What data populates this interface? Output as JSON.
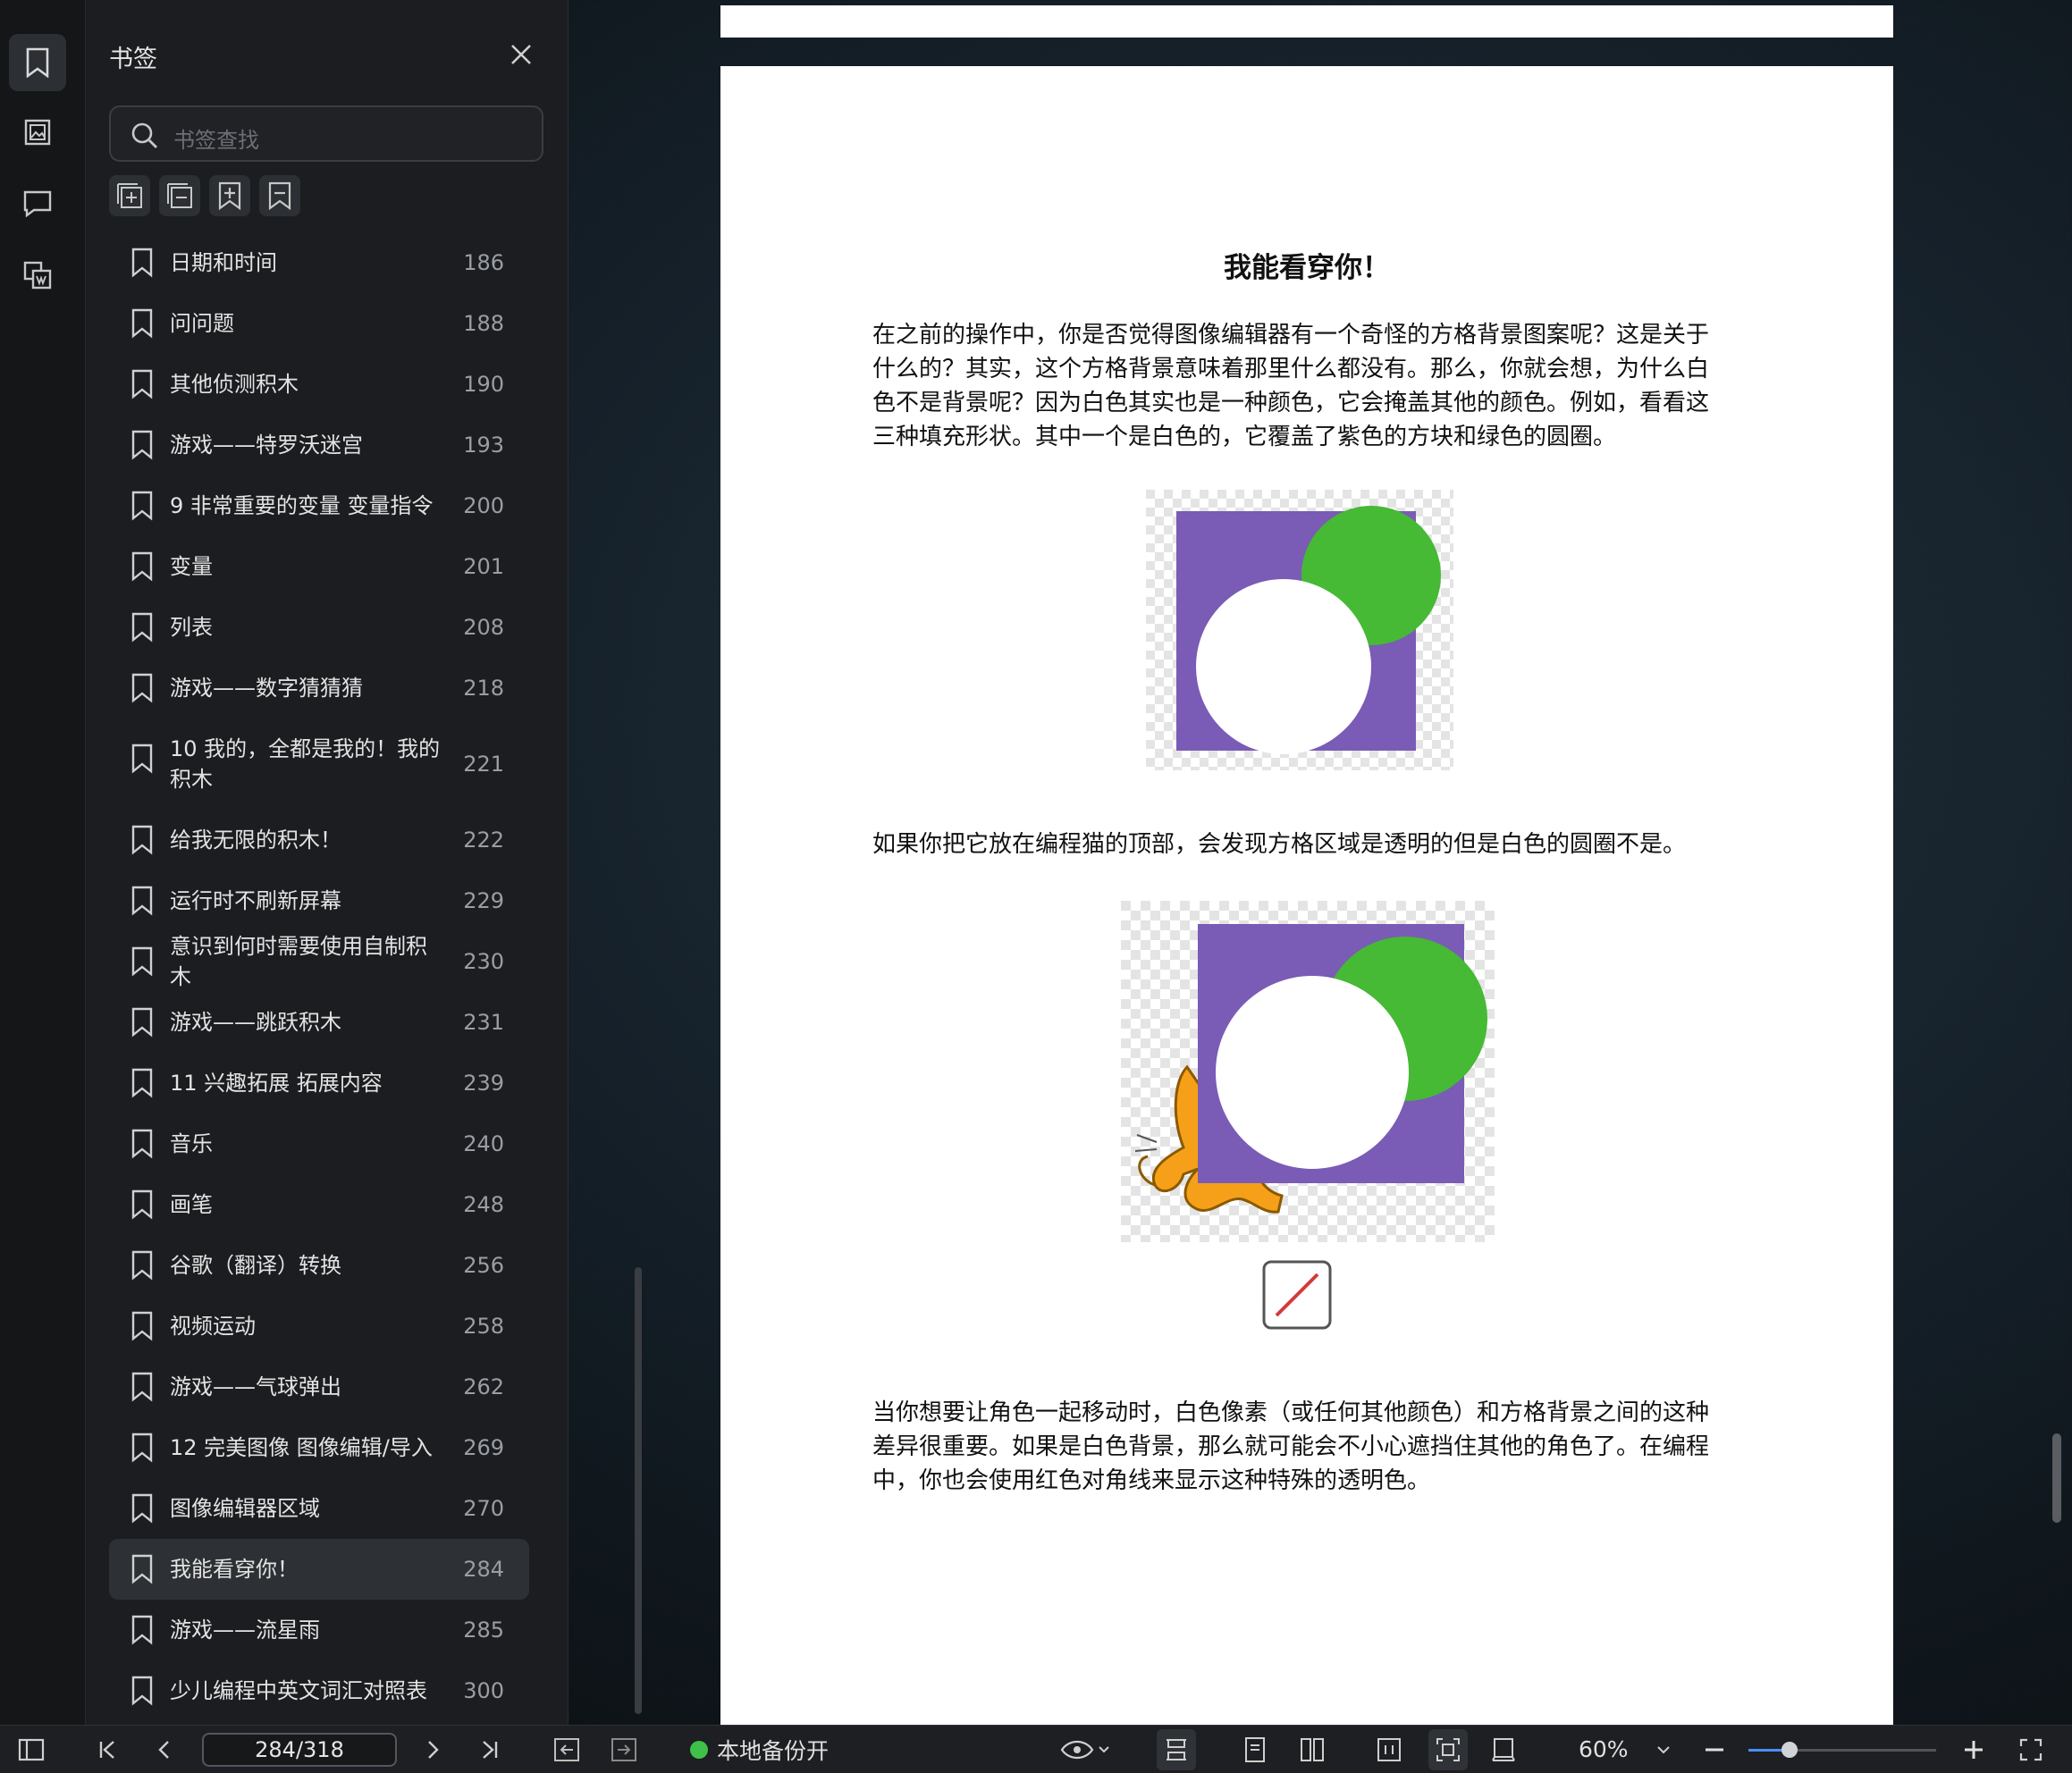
{
  "sidebar": {
    "title": "书签",
    "search_placeholder": "书签查找",
    "items": [
      {
        "label": "日期和时间",
        "page": "186"
      },
      {
        "label": "问问题",
        "page": "188"
      },
      {
        "label": "其他侦测积木",
        "page": "190"
      },
      {
        "label": "游戏——特罗沃迷宫",
        "page": "193"
      },
      {
        "label": "9 非常重要的变量 变量指令",
        "page": "200"
      },
      {
        "label": "变量",
        "page": "201"
      },
      {
        "label": "列表",
        "page": "208"
      },
      {
        "label": "游戏——数字猜猜猜",
        "page": "218"
      },
      {
        "label": "10 我的，全都是我的！我的积木",
        "page": "221"
      },
      {
        "label": "给我无限的积木！",
        "page": "222"
      },
      {
        "label": "运行时不刷新屏幕",
        "page": "229"
      },
      {
        "label": "意识到何时需要使用自制积木",
        "page": "230"
      },
      {
        "label": "游戏——跳跃积木",
        "page": "231"
      },
      {
        "label": "11 兴趣拓展 拓展内容",
        "page": "239"
      },
      {
        "label": "音乐",
        "page": "240"
      },
      {
        "label": "画笔",
        "page": "248"
      },
      {
        "label": "谷歌（翻译）转换",
        "page": "256"
      },
      {
        "label": "视频运动",
        "page": "258"
      },
      {
        "label": "游戏——气球弹出",
        "page": "262"
      },
      {
        "label": "12 完美图像 图像编辑/导入",
        "page": "269"
      },
      {
        "label": "图像编辑器区域",
        "page": "270"
      },
      {
        "label": "我能看穿你！",
        "page": "284"
      },
      {
        "label": "游戏——流星雨",
        "page": "285"
      },
      {
        "label": "少儿编程中英文词汇对照表",
        "page": "300"
      }
    ]
  },
  "document": {
    "heading": "我能看穿你！",
    "para1": "在之前的操作中，你是否觉得图像编辑器有一个奇怪的方格背景图案呢？这是关于什么的？其实，这个方格背景意味着那里什么都没有。那么，你就会想，为什么白色不是背景呢？因为白色其实也是一种颜色，它会掩盖其他的颜色。例如，看看这三种填充形状。其中一个是白色的，它覆盖了紫色的方块和绿色的圆圈。",
    "para2": "如果你把它放在编程猫的顶部，会发现方格区域是透明的但是白色的圆圈不是。",
    "para3": "当你想要让角色一起移动时，白色像素（或任何其他颜色）和方格背景之间的这种差异很重要。如果是白色背景，那么就可能会不小心遮挡住其他的角色了。在编程中，你也会使用红色对角线来显示这种特殊的透明色。"
  },
  "toolbar": {
    "page_indicator": "284/318",
    "backup_label": "本地备份开",
    "zoom": "60%",
    "zoom_fraction": 0.22
  },
  "colors": {
    "purple": "#7a5bb6",
    "green": "#46b935",
    "backup_dot": "#3fc04a",
    "accent": "#4c8dff"
  }
}
